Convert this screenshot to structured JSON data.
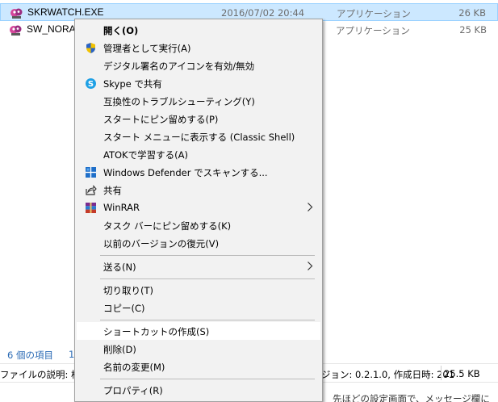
{
  "files": [
    {
      "name": "SKRWATCH.EXE",
      "date": "2016/07/02 20:44",
      "type": "アプリケーション",
      "size": "26 KB",
      "selected": true,
      "icon": "application-icon"
    },
    {
      "name": "SW_NORA",
      "date": "",
      "type": "アプリケーション",
      "size": "25 KB",
      "selected": false,
      "icon": "application-icon"
    }
  ],
  "menu": {
    "items": [
      {
        "label": "開く(O)",
        "bold": true,
        "icon": ""
      },
      {
        "label": "管理者として実行(A)",
        "icon": "uac-shield-icon"
      },
      {
        "label": "デジタル署名のアイコンを有効/無効",
        "icon": ""
      },
      {
        "label": "Skype で共有",
        "icon": "skype-icon"
      },
      {
        "label": "互換性のトラブルシューティング(Y)",
        "icon": ""
      },
      {
        "label": "スタートにピン留めする(P)",
        "icon": ""
      },
      {
        "label": "スタート メニューに表示する (Classic Shell)",
        "icon": ""
      },
      {
        "label": "ATOKで学習する(A)",
        "icon": ""
      },
      {
        "label": "Windows Defender でスキャンする...",
        "icon": "windows-defender-icon"
      },
      {
        "label": "共有",
        "icon": "share-icon"
      },
      {
        "label": "WinRAR",
        "icon": "winrar-icon",
        "submenu": true
      },
      {
        "label": "タスク バーにピン留めする(K)",
        "icon": ""
      },
      {
        "label": "以前のバージョンの復元(V)",
        "icon": ""
      },
      {
        "label": "送る(N)",
        "icon": "",
        "submenu": true
      },
      {
        "label": "切り取り(T)",
        "icon": ""
      },
      {
        "label": "コピー(C)",
        "icon": ""
      },
      {
        "label": "ショートカットの作成(S)",
        "icon": "",
        "highlighted": true
      },
      {
        "label": "削除(D)",
        "icon": ""
      },
      {
        "label": "名前の変更(M)",
        "icon": ""
      },
      {
        "label": "プロパティ(R)",
        "icon": ""
      }
    ]
  },
  "status": {
    "item_count": "6 個の項目",
    "item_count_fragment": "1"
  },
  "details": {
    "description": "ファイルの説明: 桜",
    "version_info": "ジョン: 0.2.1.0, 作成日時: 201",
    "size": "25.5 KB"
  },
  "bottom_text": "先ほどの設定画面で、メッセージ欄に",
  "colors": {
    "selection_bg": "#cce8ff",
    "selection_border": "#99d1ff",
    "menu_bg": "#f2f2f2",
    "status_text": "#2b6bb5"
  }
}
